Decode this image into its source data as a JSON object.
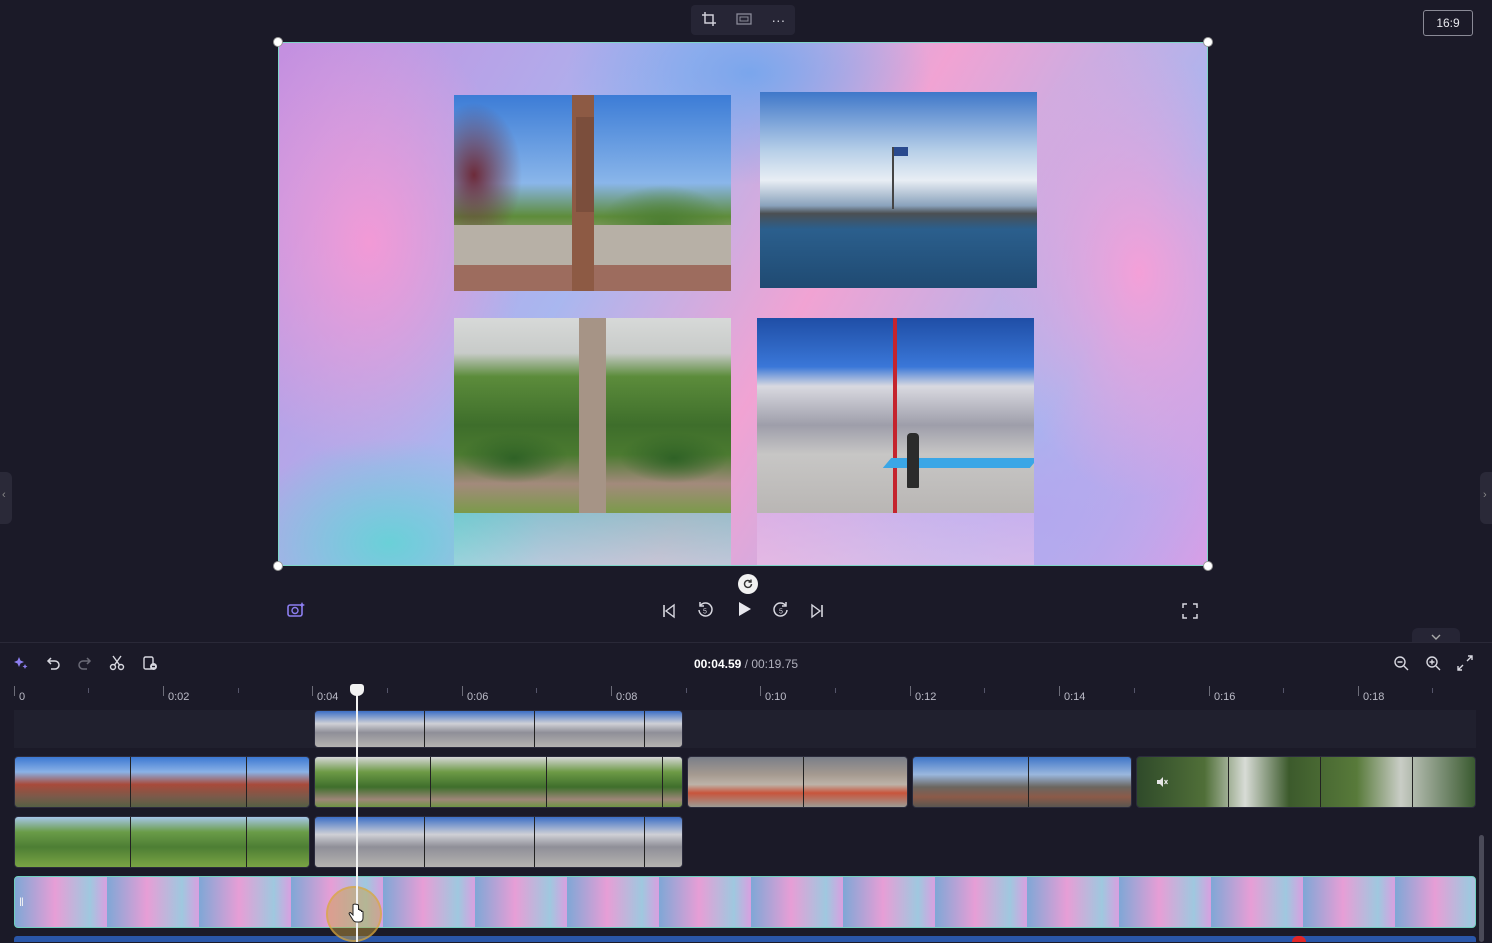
{
  "canvas_toolbar": {
    "crop_icon": "crop-icon",
    "fit_icon": "fit-icon",
    "more_icon": "more-icon",
    "more_label": "···"
  },
  "aspect_ratio": "16:9",
  "playback": {
    "current_time": "00:04.59",
    "separator": " / ",
    "total_time": "00:19.75"
  },
  "ruler_labels": [
    "0",
    "0:02",
    "0:04",
    "0:06",
    "0:08",
    "0:10",
    "0:12",
    "0:14",
    "0:16",
    "0:18"
  ],
  "colors": {
    "accent": "#7fd6c8",
    "background": "#1b1a28"
  }
}
